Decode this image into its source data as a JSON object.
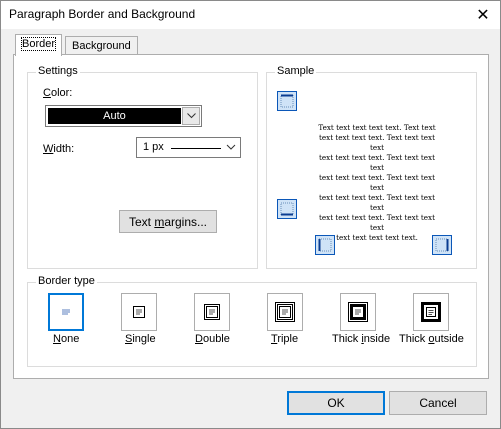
{
  "window": {
    "title": "Paragraph Border and Background",
    "close_glyph": "✕"
  },
  "tabs": [
    {
      "label": "Border",
      "active": true
    },
    {
      "label": "Background",
      "active": false
    }
  ],
  "settings": {
    "group_label": "Settings",
    "color_label": "Color:",
    "color_value": "Auto",
    "color_swatch": "#000000",
    "width_label": "Width:",
    "width_value": "1 px",
    "text_margins_button": "Text margins..."
  },
  "sample": {
    "group_label": "Sample",
    "lines": [
      "Text text text text text. Text text",
      "text text text text. Text text text text",
      "text text text text. Text text text text",
      "text text text text. Text text text text",
      "text text text text. Text text text text",
      "text text text text. Text text text text",
      "text text text text text."
    ]
  },
  "border_type": {
    "group_label": "Border type",
    "options": [
      {
        "label": "None",
        "selected": true
      },
      {
        "label": "Single",
        "selected": false
      },
      {
        "label": "Double",
        "selected": false
      },
      {
        "label": "Triple",
        "selected": false
      },
      {
        "label": "Thick inside",
        "selected": false
      },
      {
        "label": "Thick outside",
        "selected": false
      }
    ]
  },
  "buttons": {
    "ok": "OK",
    "cancel": "Cancel"
  },
  "colors": {
    "accent": "#0078d7",
    "sample_button_fill": "#cfe3f7"
  }
}
